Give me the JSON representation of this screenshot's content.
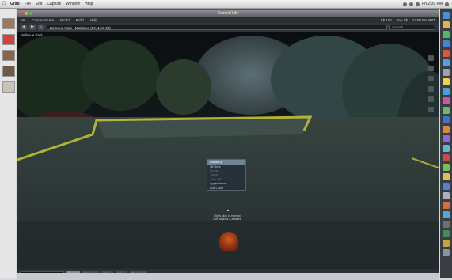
{
  "mac_menubar": {
    "apple": "",
    "items": [
      "Grab",
      "File",
      "Edit",
      "Capture",
      "Window",
      "Help"
    ],
    "clock": "Fri 2:09 PM"
  },
  "window": {
    "title": "Second Life"
  },
  "sl_menu": {
    "items": [
      "Me",
      "Communicate",
      "World",
      "Build",
      "Help"
    ],
    "status": [
      "L$ 100",
      "Buy L$",
      "12:08 PM PST"
    ]
  },
  "navbar": {
    "location": "Bellevue Park - Mainland (89, 143, 24)",
    "search_placeholder": "Search"
  },
  "viewport": {
    "region_label": "Bellevue Park"
  },
  "context_menu": {
    "header": "Stand Up",
    "items": [
      {
        "label": "Sit Here",
        "dim": false
      },
      {
        "label": "Profile...",
        "dim": true
      },
      {
        "label": "Touch",
        "dim": true
      },
      {
        "label": "Take Off",
        "dim": true
      },
      {
        "label": "Appearance",
        "dim": false
      },
      {
        "label": "Edit Outfit",
        "dim": false
      }
    ]
  },
  "hint": {
    "line1": "Right-click to interact",
    "line2": "with objects & avatars"
  },
  "bottombar": {
    "chat_placeholder": "Chat to nearby",
    "buttons": [
      "Speak",
      "Gestures",
      "Move",
      "View",
      "Snapshot"
    ]
  },
  "colors": {
    "terrain": "#2e3a3c",
    "boundary": "#c8c63a",
    "sky": "#0e1113"
  }
}
